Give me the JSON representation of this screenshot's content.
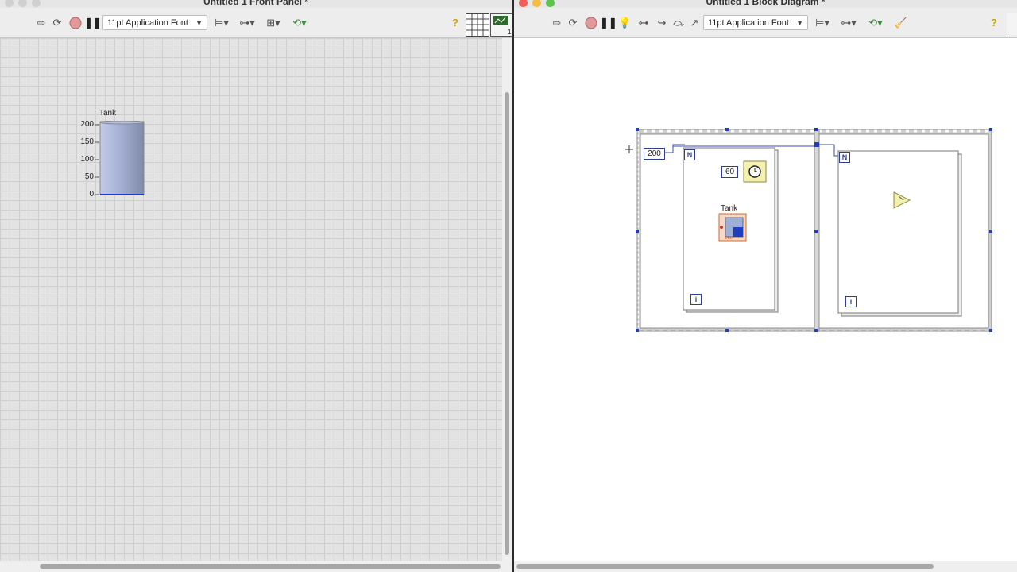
{
  "front_panel": {
    "title": "Untitled 1 Front Panel *",
    "font": "11pt Application Font",
    "tank": {
      "label": "Tank",
      "scale": [
        "200",
        "150",
        "100",
        "50",
        "0"
      ],
      "level": 0
    }
  },
  "block_diagram": {
    "title": "Untitled 1 Block Diagram *",
    "font": "11pt Application Font",
    "loop1": {
      "count": "200",
      "count_terminal": "N",
      "iteration_terminal": "i",
      "wait_ms": "60",
      "tank_label": "Tank"
    },
    "loop2": {
      "count_terminal": "N",
      "iteration_terminal": "i"
    }
  },
  "colors": {
    "selection_blue": "#1f3fbf",
    "wire_blue": "#3a4fa8",
    "tank_fill": "#a9b6dc"
  }
}
